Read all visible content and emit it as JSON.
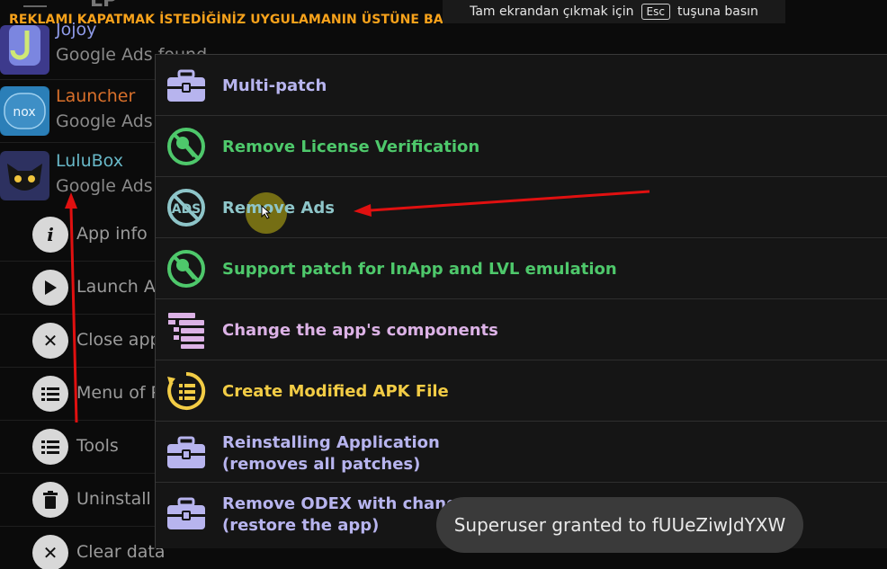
{
  "top_hint": "REKLAMI KAPATMAK İSTEDİĞİNİZ UYGULAMANIN ÜSTÜNE BASILI TUTUN",
  "esc_banner": {
    "before": "Tam ekrandan çıkmak için",
    "key": "Esc",
    "after": "tuşuna basın"
  },
  "header": {
    "title": "LP"
  },
  "apps": [
    {
      "name": "Jojoy",
      "status": "Google Ads found",
      "name_color": "#8f9be8"
    },
    {
      "name": "Launcher",
      "status": "Google Ads",
      "name_color": "#d9702b"
    },
    {
      "name": "LuluBox",
      "status": "Google Ads",
      "name_color": "#68b8c8"
    }
  ],
  "app_menu": [
    {
      "label": "App info",
      "icon": "info-icon"
    },
    {
      "label": "Launch Ap",
      "icon": "play-icon"
    },
    {
      "label": "Close app",
      "icon": "close-icon"
    },
    {
      "label": "Menu of P",
      "icon": "list-icon"
    },
    {
      "label": "Tools",
      "icon": "list-icon"
    },
    {
      "label": "Uninstall A",
      "icon": "trash-icon"
    },
    {
      "label": "Clear data",
      "icon": "close-icon"
    }
  ],
  "menu": {
    "items": [
      {
        "line1": "Multi-patch",
        "line2": "",
        "icon": "toolbox-icon",
        "color": "#b7b4ee"
      },
      {
        "line1": "Remove License Verification",
        "line2": "",
        "icon": "license-blocked-icon",
        "color": "#4ec86b"
      },
      {
        "line1": "Remove Ads",
        "line2": "",
        "icon": "ads-blocked-icon",
        "color": "#8ec5c9"
      },
      {
        "line1": "Support patch for InApp and LVL emulation",
        "line2": "",
        "icon": "license-blocked-icon",
        "color": "#4ec86b"
      },
      {
        "line1": "Change the app's components",
        "line2": "",
        "icon": "components-icon",
        "color": "#dcb2e6"
      },
      {
        "line1": "Create Modified APK File",
        "line2": "",
        "icon": "rebuild-apk-icon",
        "color": "#f2cc45"
      },
      {
        "line1": "Reinstalling Application",
        "line2": "(removes all patches)",
        "icon": "toolbox-icon",
        "color": "#b7b4ee"
      },
      {
        "line1": "Remove ODEX with changes",
        "line2": "(restore the app)",
        "icon": "toolbox-icon",
        "color": "#b7b4ee"
      }
    ]
  },
  "toast": {
    "text": "Superuser granted to fUUeZiwJdYXW"
  }
}
